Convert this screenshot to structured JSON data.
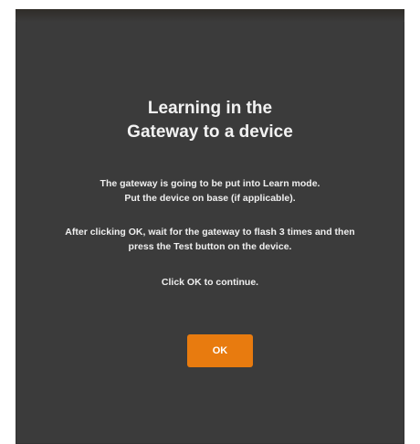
{
  "dialog": {
    "title_line1": "Learning in the",
    "title_line2": "Gateway to a device",
    "paragraph1_line1": "The gateway is going to be put into Learn mode.",
    "paragraph1_line2": "Put the device on base (if applicable).",
    "paragraph2_line1": "After clicking OK, wait for the gateway to flash 3 times and then",
    "paragraph2_line2": "press the Test button on the device.",
    "paragraph3": "Click OK to continue.",
    "ok_label": "OK"
  },
  "colors": {
    "dialog_background": "#3b3b3b",
    "accent": "#e87b0f",
    "text": "#f2f2f2"
  }
}
